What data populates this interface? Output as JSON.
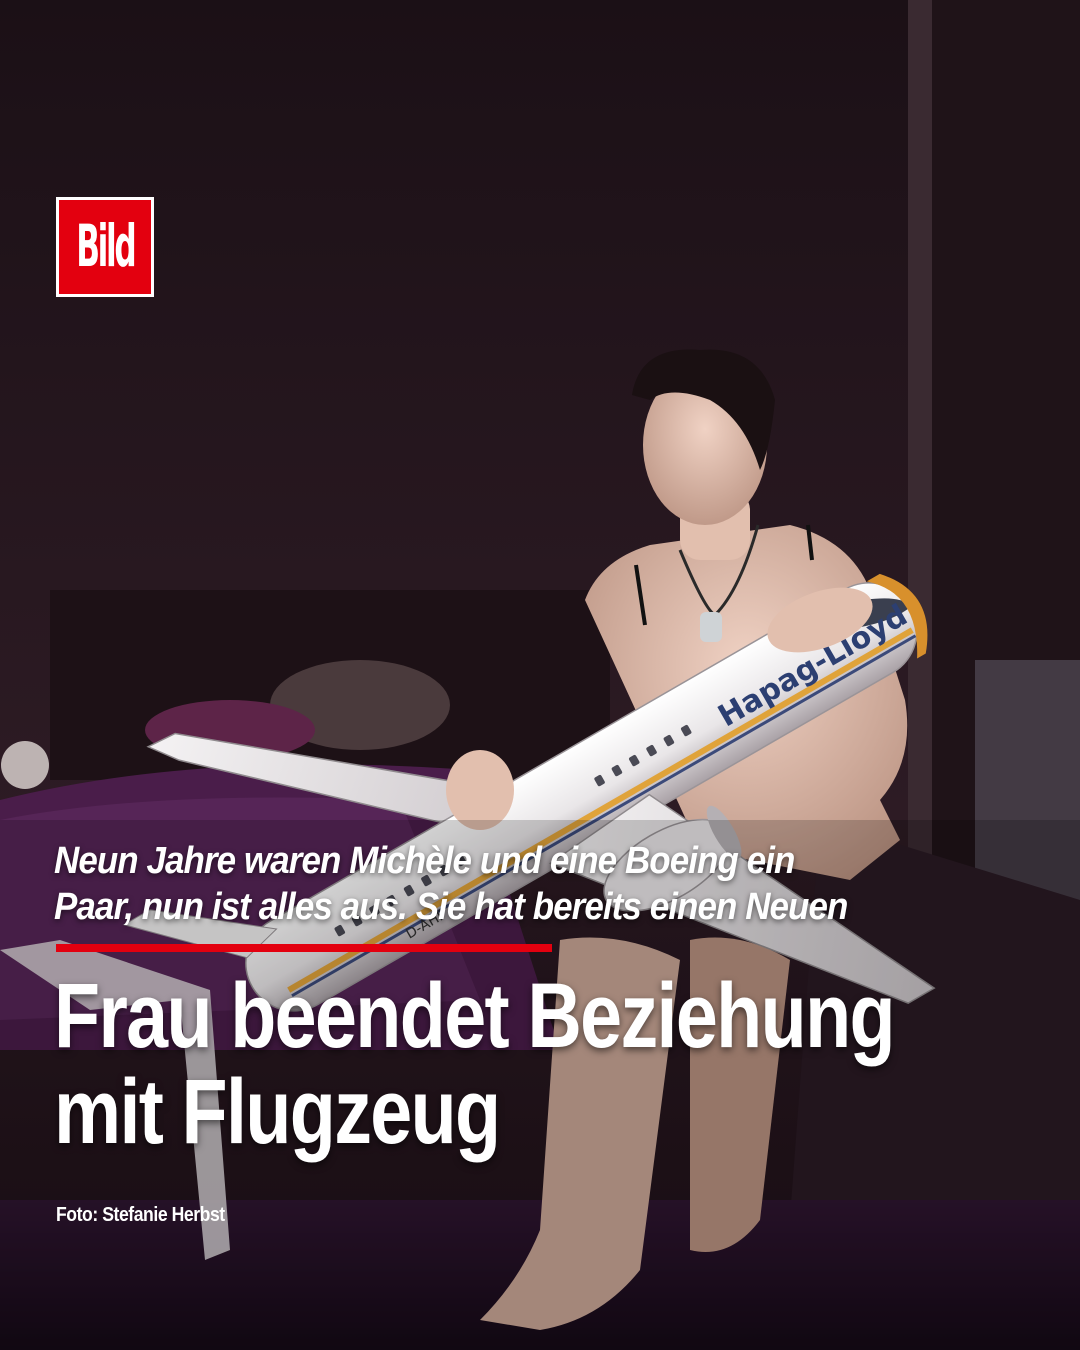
{
  "brand": {
    "logo_text": "Bild",
    "accent_color": "#e3000f"
  },
  "article": {
    "subtitle_line1": "Neun Jahre waren Michèle und eine Boeing ein",
    "subtitle_line2": "Paar, nun ist alles aus. Sie hat bereits einen Neuen",
    "headline_line1": "Frau beendet Beziehung",
    "headline_line2": "mit Flugzeug",
    "photo_credit": "Foto: Stefanie Herbst"
  },
  "photo": {
    "aircraft_livery_text": "Hapag-Lloyd",
    "registration_text": "D-AHF"
  }
}
